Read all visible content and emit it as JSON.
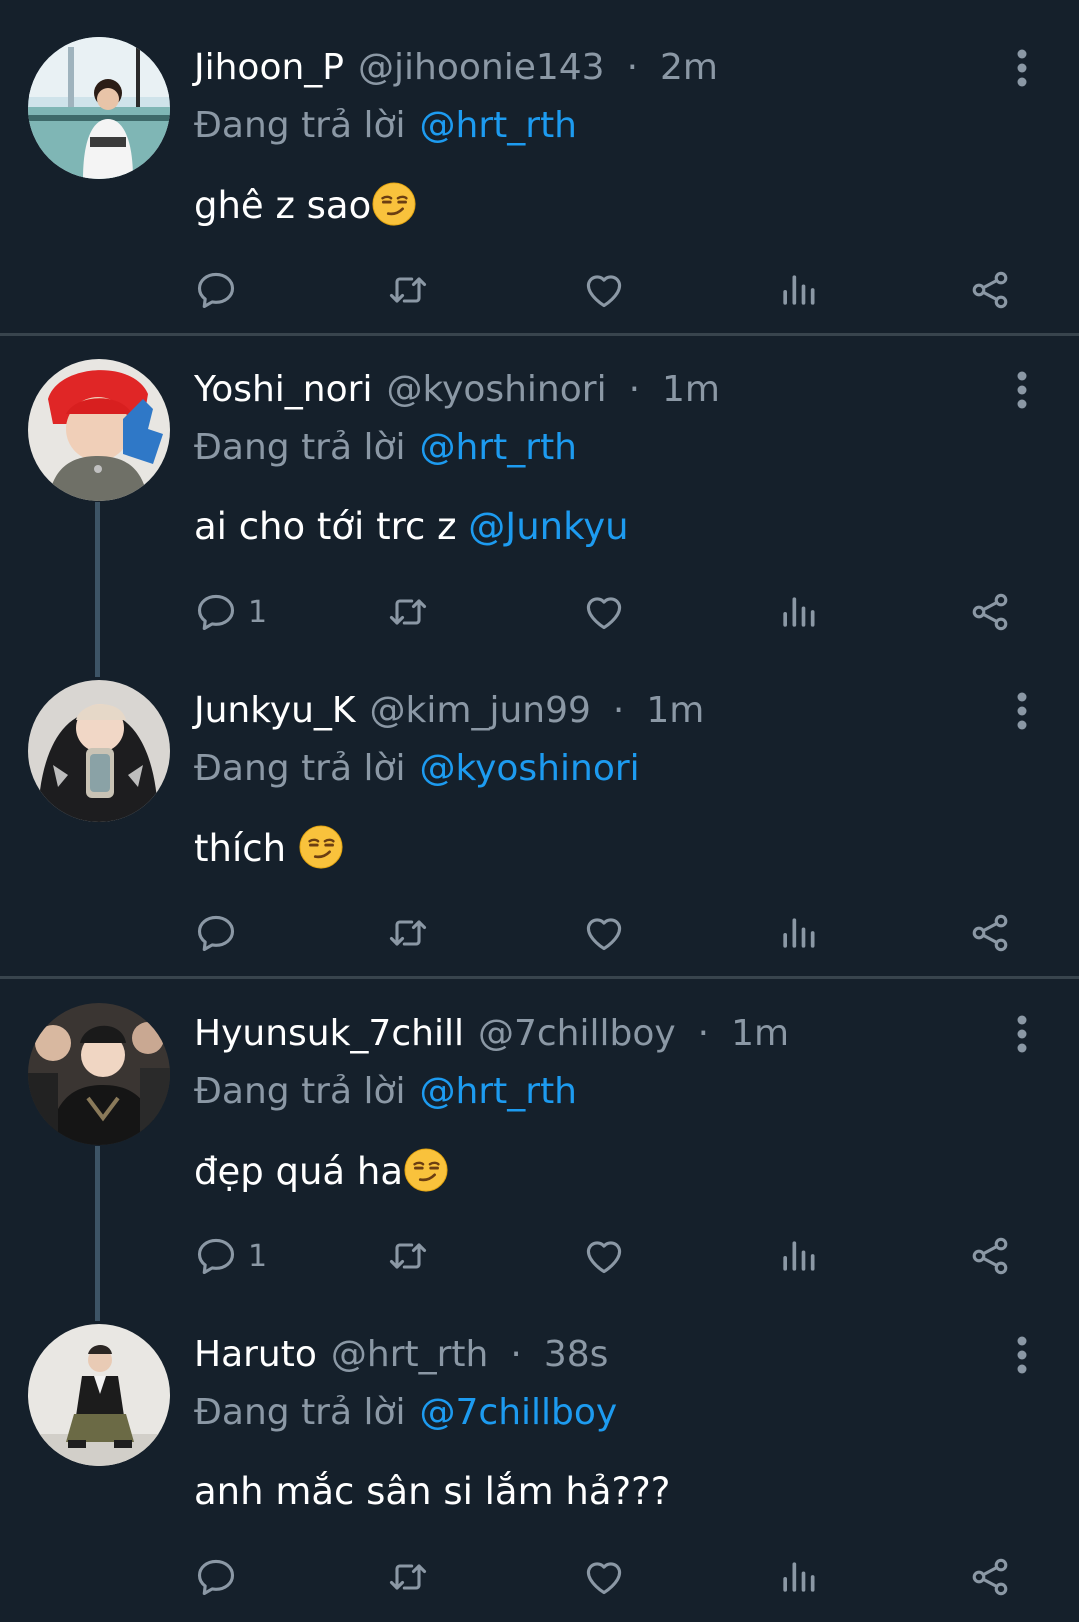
{
  "tweets": [
    {
      "name": "Jihoon_P",
      "handle": "@jihoonie143",
      "sep": "·",
      "time": "2m",
      "reply_prefix": "Đang trả lời",
      "reply_to": "@hrt_rth",
      "text": "ghê z sao",
      "text_mention": "",
      "emoji": "smirking-face",
      "reply_count": ""
    },
    {
      "name": "Yoshi_nori",
      "handle": "@kyoshinori",
      "sep": "·",
      "time": "1m",
      "reply_prefix": "Đang trả lời",
      "reply_to": "@hrt_rth",
      "text": "ai cho tới trc z ",
      "text_mention": "@Junkyu",
      "emoji": "",
      "reply_count": "1"
    },
    {
      "name": "Junkyu_K",
      "handle": "@kim_jun99",
      "sep": "·",
      "time": "1m",
      "reply_prefix": "Đang trả lời",
      "reply_to": "@kyoshinori",
      "text": "thích ",
      "text_mention": "",
      "emoji": "smirking-face",
      "reply_count": ""
    },
    {
      "name": "Hyunsuk_7chill",
      "handle": "@7chillboy",
      "sep": "·",
      "time": "1m",
      "reply_prefix": "Đang trả lời",
      "reply_to": "@hrt_rth",
      "text": "đẹp quá ha",
      "text_mention": "",
      "emoji": "smirking-face",
      "reply_count": "1"
    },
    {
      "name": "Haruto",
      "handle": "@hrt_rth",
      "sep": "·",
      "time": "38s",
      "reply_prefix": "Đang trả lời",
      "reply_to": "@7chillboy",
      "text": "anh mắc sân si lắm hả???",
      "text_mention": "",
      "emoji": "",
      "reply_count": ""
    }
  ],
  "icons": {
    "reply": "speech-bubble-icon",
    "retweet": "retweet-icon",
    "like": "heart-icon",
    "views": "bar-chart-icon",
    "share": "share-icon",
    "more": "vertical-ellipsis-icon"
  },
  "colors": {
    "background": "#15202b",
    "accent": "#1d9bf0",
    "muted": "#8b98a5",
    "divider": "#38444d"
  }
}
